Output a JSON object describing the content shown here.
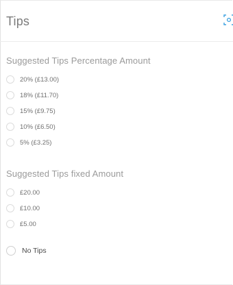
{
  "header": {
    "title": "Tips",
    "scan_icon": "scan-icon"
  },
  "percentage_section": {
    "title": "Suggested Tips Percentage Amount",
    "options": [
      {
        "label": "20% (£13.00)"
      },
      {
        "label": "18% (£11.70)"
      },
      {
        "label": "15% (£9.75)"
      },
      {
        "label": "10% (£6.50)"
      },
      {
        "label": "5% (£3.25)"
      }
    ]
  },
  "fixed_section": {
    "title": "Suggested Tips fixed Amount",
    "options": [
      {
        "label": "£20.00"
      },
      {
        "label": "£10.00"
      },
      {
        "label": "£5.00"
      }
    ]
  },
  "no_tips": {
    "label": "No Tips"
  },
  "colors": {
    "accent": "#3aa0e0",
    "radio_border": "#dcdcdc"
  }
}
